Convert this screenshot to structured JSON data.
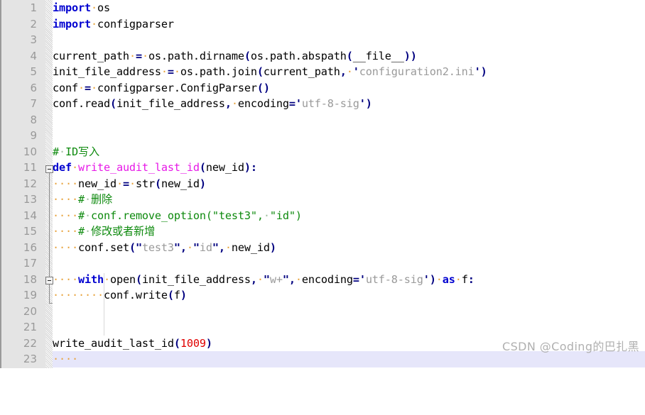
{
  "editor": {
    "language": "Python",
    "theme": "light",
    "current_line": 23,
    "total_lines_visible": 23,
    "colors": {
      "background": "#ffffff",
      "gutter_background": "#e4e4e4",
      "line_number": "#999999",
      "current_line_highlight": "#e6e6fa",
      "keyword": "#0000d0",
      "function_name": "#e718e7",
      "string": "#9a9a9a",
      "punctuation": "#000080",
      "number": "#e00000",
      "comment": "#0e8a0e",
      "whitespace_dot": "#e8a33d",
      "watermark": "#b0b0b0"
    }
  },
  "line_numbers": [
    "1",
    "2",
    "3",
    "4",
    "5",
    "6",
    "7",
    "8",
    "9",
    "10",
    "11",
    "12",
    "13",
    "14",
    "15",
    "16",
    "17",
    "18",
    "19",
    "20",
    "21",
    "22",
    "23"
  ],
  "code_lines": [
    {
      "n": "1",
      "text": "import os"
    },
    {
      "n": "2",
      "text": "import configparser"
    },
    {
      "n": "3",
      "text": ""
    },
    {
      "n": "4",
      "text": "current_path = os.path.dirname(os.path.abspath(__file__))"
    },
    {
      "n": "5",
      "text": "init_file_address = os.path.join(current_path, 'configuration2.ini')"
    },
    {
      "n": "6",
      "text": "conf = configparser.ConfigParser()"
    },
    {
      "n": "7",
      "text": "conf.read(init_file_address, encoding='utf-8-sig')"
    },
    {
      "n": "8",
      "text": ""
    },
    {
      "n": "9",
      "text": ""
    },
    {
      "n": "10",
      "text": "# ID写入"
    },
    {
      "n": "11",
      "text": "def write_audit_last_id(new_id):"
    },
    {
      "n": "12",
      "text": "    new_id = str(new_id)"
    },
    {
      "n": "13",
      "text": "    # 删除"
    },
    {
      "n": "14",
      "text": "    # conf.remove_option(\"test3\", \"id\")"
    },
    {
      "n": "15",
      "text": "    # 修改或者新增"
    },
    {
      "n": "16",
      "text": "    conf.set(\"test3\", \"id\", new_id)"
    },
    {
      "n": "17",
      "text": ""
    },
    {
      "n": "18",
      "text": "    with open(init_file_address, \"w+\", encoding='utf-8-sig') as f:"
    },
    {
      "n": "19",
      "text": "        conf.write(f)"
    },
    {
      "n": "20",
      "text": ""
    },
    {
      "n": "21",
      "text": ""
    },
    {
      "n": "22",
      "text": "write_audit_last_id(1009)"
    },
    {
      "n": "23",
      "text": ""
    }
  ],
  "tokens": {
    "kw_import": "import",
    "kw_def": "def",
    "kw_with": "with",
    "kw_as": "as",
    "mod_os": "os",
    "mod_configparser": "configparser",
    "var_current_path": "current_path",
    "var_init_file_address": "init_file_address",
    "var_conf": "conf",
    "var_new_id": "new_id",
    "var_f": "f",
    "call_os_path_dirname": "os.path.dirname",
    "call_os_path_abspath": "os.path.abspath",
    "call_os_path_join": "os.path.join",
    "call_configparser": "configparser.ConfigParser",
    "call_conf_read": "conf.read",
    "call_conf_set": "conf.set",
    "call_conf_write": "conf.write",
    "call_str": "str",
    "call_open": "open",
    "dunder_file": "__file__",
    "fn_name": "write_audit_last_id",
    "kwarg_encoding": "encoding",
    "str_config_ini": "configuration2.ini",
    "str_utf8sig": "utf-8-sig",
    "str_test3": "test3",
    "str_id": "id",
    "str_wplus": "w+",
    "num_1009": "1009",
    "comment_id_write": "# ID写入",
    "comment_delete": "# 删除",
    "comment_remove_option": "# conf.remove_option(\"test3\", \"id\")",
    "comment_modify_or_add": "# 修改或者新增"
  },
  "fold_markers": [
    {
      "line": 11,
      "state": "expanded",
      "label": "collapse-def-write-audit-last-id"
    },
    {
      "line": 18,
      "state": "expanded",
      "label": "collapse-with-block"
    }
  ],
  "watermark": {
    "text": "CSDN @Coding的巴扎黑"
  }
}
